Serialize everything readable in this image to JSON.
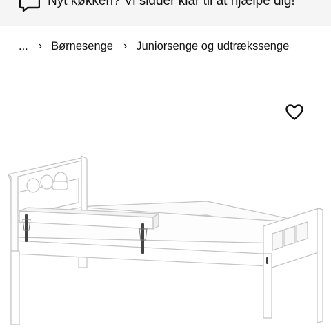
{
  "banner": {
    "text": "Nyt køkken? Vi sidder klar til at hjælpe dig!",
    "icon": "chat-bubble-icon"
  },
  "breadcrumb": {
    "ellipsis": "...",
    "separator": "›",
    "items": [
      {
        "label": "Børnesenge"
      },
      {
        "label": "Juniorsenge og udtrækssenge"
      }
    ]
  },
  "product": {
    "favorite_icon": "heart-icon"
  },
  "colors": {
    "banner_bg": "#f5f5f5",
    "text": "#111111",
    "page_bg": "#ffffff"
  }
}
